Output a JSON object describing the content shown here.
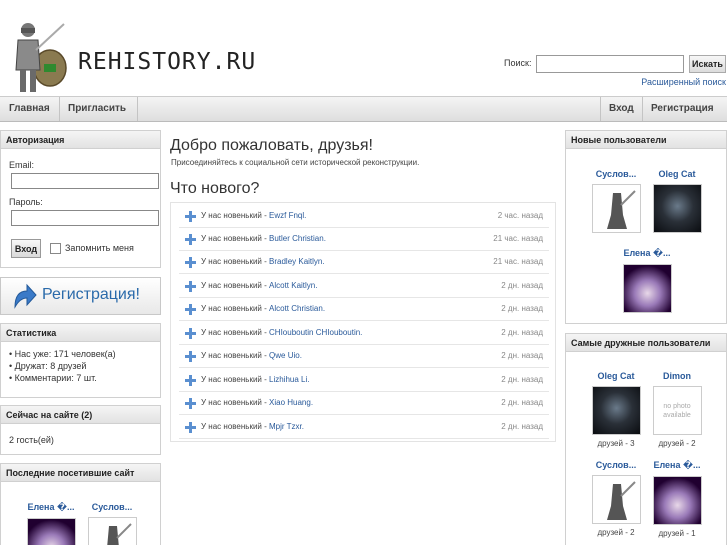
{
  "site": {
    "logo_text": "REHISTORY.RU"
  },
  "search": {
    "label": "Поиск:",
    "button": "Искать",
    "advanced": "Расширенный поиск",
    "placeholder": ""
  },
  "nav": {
    "home": "Главная",
    "invite": "Пригласить",
    "login": "Вход",
    "register": "Регистрация"
  },
  "auth": {
    "title": "Авторизация",
    "email_label": "Email:",
    "password_label": "Пароль:",
    "login_button": "Вход",
    "remember": "Запомнить меня"
  },
  "register_banner": {
    "label": "Регистрация!"
  },
  "stats": {
    "title": "Статистика",
    "items": [
      "• Нас уже: 171 человек(а)",
      "• Дружат: 8 друзей",
      "• Комментарии: 7 шт."
    ]
  },
  "online": {
    "title": "Сейчас на сайте (2)",
    "text": "2 гость(ей)"
  },
  "recent": {
    "title": "Последние посетившие сайт",
    "users": [
      {
        "name": "Елена �...",
        "photo": "face-photo"
      },
      {
        "name": "Суслов...",
        "photo": "knight-photo"
      }
    ]
  },
  "main": {
    "welcome": "Добро пожаловать, друзья!",
    "subtitle": "Присоединяйтесь к социальной сети исторической реконструкции.",
    "whats_new": "Что нового?",
    "feed": [
      {
        "prefix": "У нас новенький - ",
        "name": "Ewzf Fnql.",
        "time": "2 час. назад"
      },
      {
        "prefix": "У нас новенький - ",
        "name": "Butler Christian.",
        "time": "21 час. назад"
      },
      {
        "prefix": "У нас новенький - ",
        "name": "Bradley Kaitlyn.",
        "time": "21 час. назад"
      },
      {
        "prefix": "У нас новенький - ",
        "name": "Alcott Kaitlyn.",
        "time": "2 дн. назад"
      },
      {
        "prefix": "У нас новенький - ",
        "name": "Alcott Christian.",
        "time": "2 дн. назад"
      },
      {
        "prefix": "У нас новенький - ",
        "name": "CHIouboutin CHIouboutin.",
        "time": "2 дн. назад"
      },
      {
        "prefix": "У нас новенький - ",
        "name": "Qwe Uio.",
        "time": "2 дн. назад"
      },
      {
        "prefix": "У нас новенький - ",
        "name": "Lizhihua Li.",
        "time": "2 дн. назад"
      },
      {
        "prefix": "У нас новенький - ",
        "name": "Xiao Huang.",
        "time": "2 дн. назад"
      },
      {
        "prefix": "У нас новенький - ",
        "name": "Mpjr Tzxr.",
        "time": "2 дн. назад"
      }
    ]
  },
  "new_users": {
    "title": "Новые пользователи",
    "users": [
      {
        "name": "Суслов...",
        "photo": "knight-photo"
      },
      {
        "name": "Oleg Cat",
        "photo": "dark-photo"
      },
      {
        "name": "Елена �...",
        "photo": "face-photo"
      }
    ]
  },
  "friendly_users": {
    "title": "Самые дружные пользователи",
    "users": [
      {
        "name": "Oleg Cat",
        "friends": "друзей - 3",
        "photo": "dark-photo"
      },
      {
        "name": "Dimon",
        "friends": "друзей - 2",
        "photo": "no-photo",
        "no_photo_text": "no photo available"
      },
      {
        "name": "Суслов...",
        "friends": "друзей - 2",
        "photo": "knight-photo"
      },
      {
        "name": "Елена �...",
        "friends": "друзей - 1",
        "photo": "face-photo"
      }
    ]
  }
}
